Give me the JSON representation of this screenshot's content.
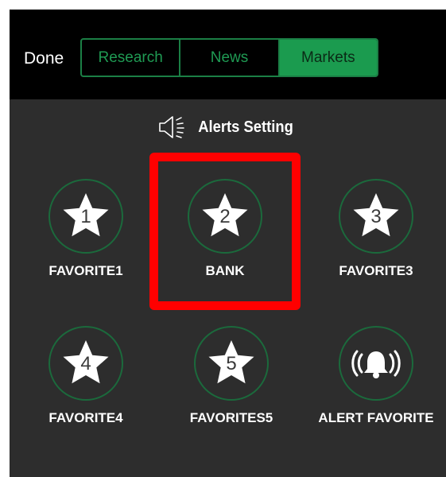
{
  "header": {
    "done_label": "Done",
    "tabs": [
      {
        "label": "Research",
        "active": false
      },
      {
        "label": "News",
        "active": false
      },
      {
        "label": "Markets",
        "active": true
      }
    ]
  },
  "alerts_setting": {
    "label": "Alerts Setting",
    "icon": "speaker-icon"
  },
  "tiles": [
    {
      "number": "1",
      "label": "FAVORITE1",
      "icon": "star-icon"
    },
    {
      "number": "2",
      "label": "BANK",
      "icon": "star-icon",
      "highlighted": true
    },
    {
      "number": "3",
      "label": "FAVORITE3",
      "icon": "star-icon"
    },
    {
      "number": "4",
      "label": "FAVORITE4",
      "icon": "star-icon"
    },
    {
      "number": "5",
      "label": "FAVORITES5",
      "icon": "star-icon"
    },
    {
      "label": "ALERT FAVORITE",
      "icon": "bell-icon"
    }
  ],
  "colors": {
    "accent_green": "#1b9b4f",
    "circle_border": "#1b6a3c",
    "highlight": "#ff0000",
    "background": "#2d2d2d"
  }
}
